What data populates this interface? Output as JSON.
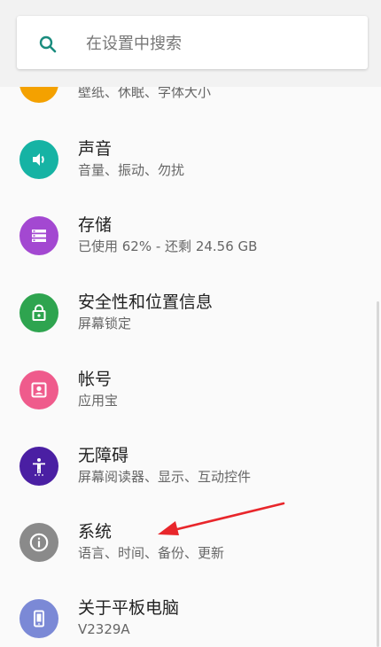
{
  "search": {
    "placeholder": "在设置中搜索",
    "icon": "search-icon",
    "accent": "#1a8c7e"
  },
  "items": [
    {
      "id": "display",
      "title": "",
      "subtitle": "壁纸、休眠、字体大小",
      "icon": "display-icon",
      "color": "#f4a100"
    },
    {
      "id": "sound",
      "title": "声音",
      "subtitle": "音量、振动、勿扰",
      "icon": "volume-icon",
      "color": "#16b3a4"
    },
    {
      "id": "storage",
      "title": "存储",
      "subtitle": "已使用 62% - 还剩 24.56 GB",
      "icon": "storage-icon",
      "color": "#a348d1"
    },
    {
      "id": "security",
      "title": "安全性和位置信息",
      "subtitle": "屏幕锁定",
      "icon": "lock-icon",
      "color": "#2ea44f"
    },
    {
      "id": "accounts",
      "title": "帐号",
      "subtitle": "应用宝",
      "icon": "account-icon",
      "color": "#ef5b8c"
    },
    {
      "id": "accessibility",
      "title": "无障碍",
      "subtitle": "屏幕阅读器、显示、互动控件",
      "icon": "accessibility-icon",
      "color": "#4a1fa3"
    },
    {
      "id": "system",
      "title": "系统",
      "subtitle": "语言、时间、备份、更新",
      "icon": "info-icon",
      "color": "#8a8a8a"
    },
    {
      "id": "about",
      "title": "关于平板电脑",
      "subtitle": "V2329A",
      "icon": "tablet-icon",
      "color": "#7b89d6"
    }
  ],
  "annotation": {
    "icon": "red-arrow-icon",
    "color": "#e8262b"
  }
}
